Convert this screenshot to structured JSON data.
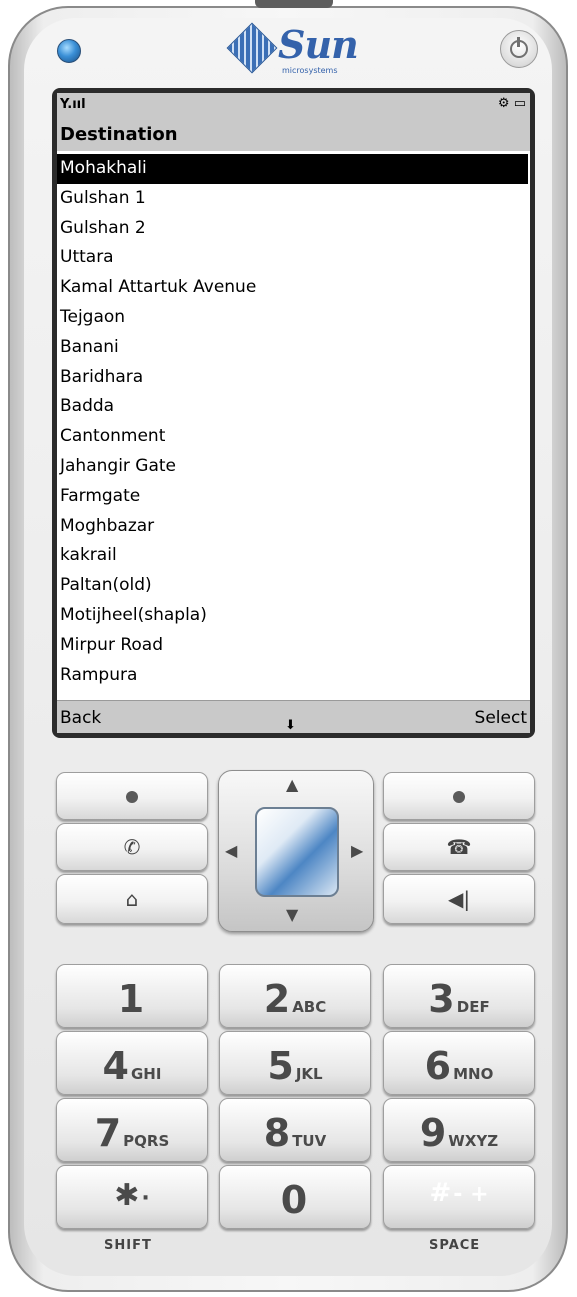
{
  "device": {
    "brand": "Sun",
    "brand_sub": "microsystems"
  },
  "status": {
    "signal": "Y.ııl",
    "icons": "⚙ ▭"
  },
  "screen": {
    "title": "Destination",
    "items": [
      "Mohakhali",
      "Gulshan 1",
      "Gulshan 2",
      "Uttara",
      "Kamal Attartuk Avenue",
      "Tejgaon",
      "Banani",
      "Baridhara",
      "Badda",
      "Cantonment",
      "Jahangir Gate",
      "Farmgate",
      "Moghbazar",
      "kakrail",
      "Paltan(old)",
      "Motijheel(shapla)",
      "Mirpur Road",
      "Rampura"
    ],
    "selected_index": 0,
    "softkey_left": "Back",
    "softkey_right": "Select",
    "scroll_indicator": "⬇"
  },
  "keys": {
    "k1": {
      "num": "1",
      "letters": ""
    },
    "k2": {
      "num": "2",
      "letters": "ABC"
    },
    "k3": {
      "num": "3",
      "letters": "DEF"
    },
    "k4": {
      "num": "4",
      "letters": "GHI"
    },
    "k5": {
      "num": "5",
      "letters": "JKL"
    },
    "k6": {
      "num": "6",
      "letters": "MNO"
    },
    "k7": {
      "num": "7",
      "letters": "PQRS"
    },
    "k8": {
      "num": "8",
      "letters": "TUV"
    },
    "k9": {
      "num": "9",
      "letters": "WXYZ"
    },
    "kstar": {
      "num": "✱",
      "letters": "·"
    },
    "k0": {
      "num": "0",
      "letters": ""
    },
    "khash": {
      "num": "#",
      "letters": "- +"
    },
    "shift_label": "SHIFT",
    "space_label": "SPACE"
  },
  "icons": {
    "call": "phone-call-icon",
    "end": "phone-hangup-icon",
    "home": "home-icon",
    "back": "back-icon",
    "up": "▲",
    "down": "▼",
    "left": "◀",
    "right": "▶"
  }
}
